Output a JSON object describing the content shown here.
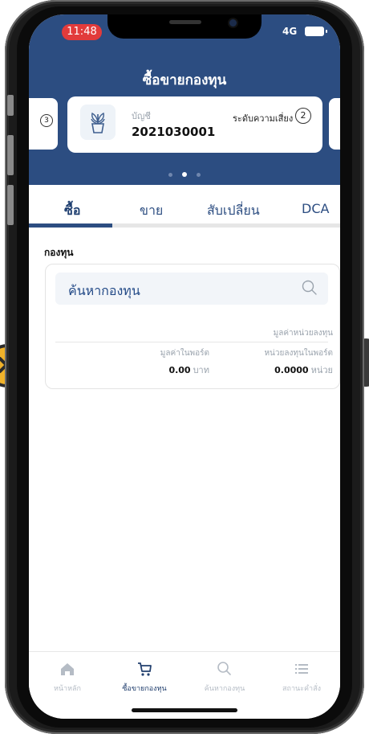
{
  "status_bar": {
    "time": "11:48",
    "network": "4G"
  },
  "header": {
    "title": "ซื้อขายกองทุน"
  },
  "account_card": {
    "label": "บัญชี",
    "number": "2021030001",
    "risk_label": "ระดับความเสี่ยง",
    "risk_level": "2",
    "prev_card_risk_level": "3"
  },
  "pager": {
    "dots": 3,
    "active": 1
  },
  "tabs": [
    {
      "label": "ซื้อ"
    },
    {
      "label": "ขาย"
    },
    {
      "label": "สับเปลี่ยน"
    },
    {
      "label": "DCA"
    }
  ],
  "fund_section": {
    "label": "กองทุน",
    "search_placeholder": "ค้นหากองทุน",
    "unit_value_label": "มูลค่าหน่วยลงทุน",
    "portfolio_value_label": "มูลค่าในพอร์ต",
    "portfolio_value": "0.00",
    "portfolio_value_unit": "บาท",
    "portfolio_units_label": "หน่วยลงทุนในพอร์ต",
    "portfolio_units": "0.0000",
    "portfolio_units_unit": "หน่วย"
  },
  "bottom_nav": [
    {
      "label": "หน้าหลัก",
      "icon": "home-icon"
    },
    {
      "label": "ซื้อขายกองทุน",
      "icon": "cart-icon",
      "active": true
    },
    {
      "label": "ค้นหากองทุน",
      "icon": "search-icon"
    },
    {
      "label": "สถานะคำสั่ง",
      "icon": "list-icon"
    }
  ],
  "colors": {
    "primary": "#2c4d81",
    "status_pill": "#e23b3b",
    "accent_arrow": "#f0b22a"
  }
}
